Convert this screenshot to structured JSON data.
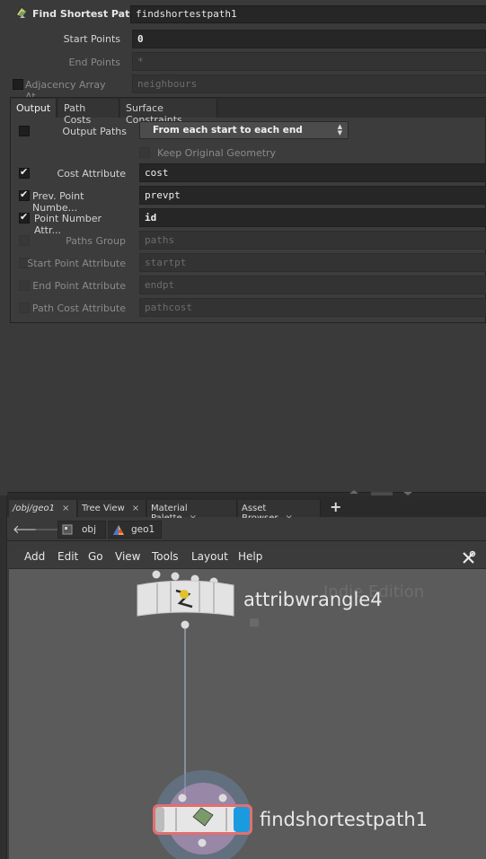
{
  "node_header": {
    "type_label": "Find Shortest Path",
    "name": "findshortestpath1"
  },
  "params_top": [
    {
      "label": "Start Points",
      "value": "0",
      "enabled": true,
      "checkbox": false
    },
    {
      "label": "End Points",
      "value": "*",
      "enabled": false,
      "checkbox": false
    },
    {
      "label": "Adjacency Array At...",
      "value": "neighbours",
      "enabled": false,
      "checkbox": true,
      "checked": false
    }
  ],
  "tabs": [
    {
      "label": "Output",
      "active": true
    },
    {
      "label": "Path Costs",
      "active": false
    },
    {
      "label": "Surface Constraints",
      "active": false
    }
  ],
  "output": {
    "output_paths_label": "Output Paths",
    "output_paths_value": "From each start to each end",
    "keep_original_geometry_label": "Keep Original Geometry",
    "params": [
      {
        "label": "Cost Attribute",
        "value": "cost",
        "checked": true,
        "enabled": true,
        "bold": false
      },
      {
        "label": "Prev. Point Numbe...",
        "value": "prevpt",
        "checked": true,
        "enabled": true,
        "bold": false
      },
      {
        "label": "Point Number Attr...",
        "value": "id",
        "checked": true,
        "enabled": true,
        "bold": true
      },
      {
        "label": "Paths Group",
        "value": "paths",
        "checked": false,
        "enabled": false,
        "bold": false
      },
      {
        "label": "Start Point Attribute",
        "value": "startpt",
        "checked": false,
        "enabled": false,
        "bold": false
      },
      {
        "label": "End Point Attribute",
        "value": "endpt",
        "checked": false,
        "enabled": false,
        "bold": false
      },
      {
        "label": "Path Cost Attribute",
        "value": "pathcost",
        "checked": false,
        "enabled": false,
        "bold": false
      }
    ]
  },
  "pane_tabs": [
    {
      "label": "/obj/geo1",
      "active": true
    },
    {
      "label": "Tree View",
      "active": false
    },
    {
      "label": "Material Palette",
      "active": false
    },
    {
      "label": "Asset Browser",
      "active": false
    }
  ],
  "pane_tab_close": "×",
  "add_tab": "+",
  "path_bar": {
    "back": "🡐",
    "forward": "🡒",
    "crumbs": [
      "obj",
      "geo1"
    ]
  },
  "network_menu": [
    "Add",
    "Edit",
    "Go",
    "View",
    "Tools",
    "Layout",
    "Help"
  ],
  "network": {
    "watermark": "Indie Edition",
    "nodes": [
      {
        "name": "attribwrangle4"
      },
      {
        "name": "findshortestpath1"
      }
    ]
  },
  "colors": {
    "display_flag": "#1a9be0",
    "selected_node_outline": "#e07070"
  }
}
